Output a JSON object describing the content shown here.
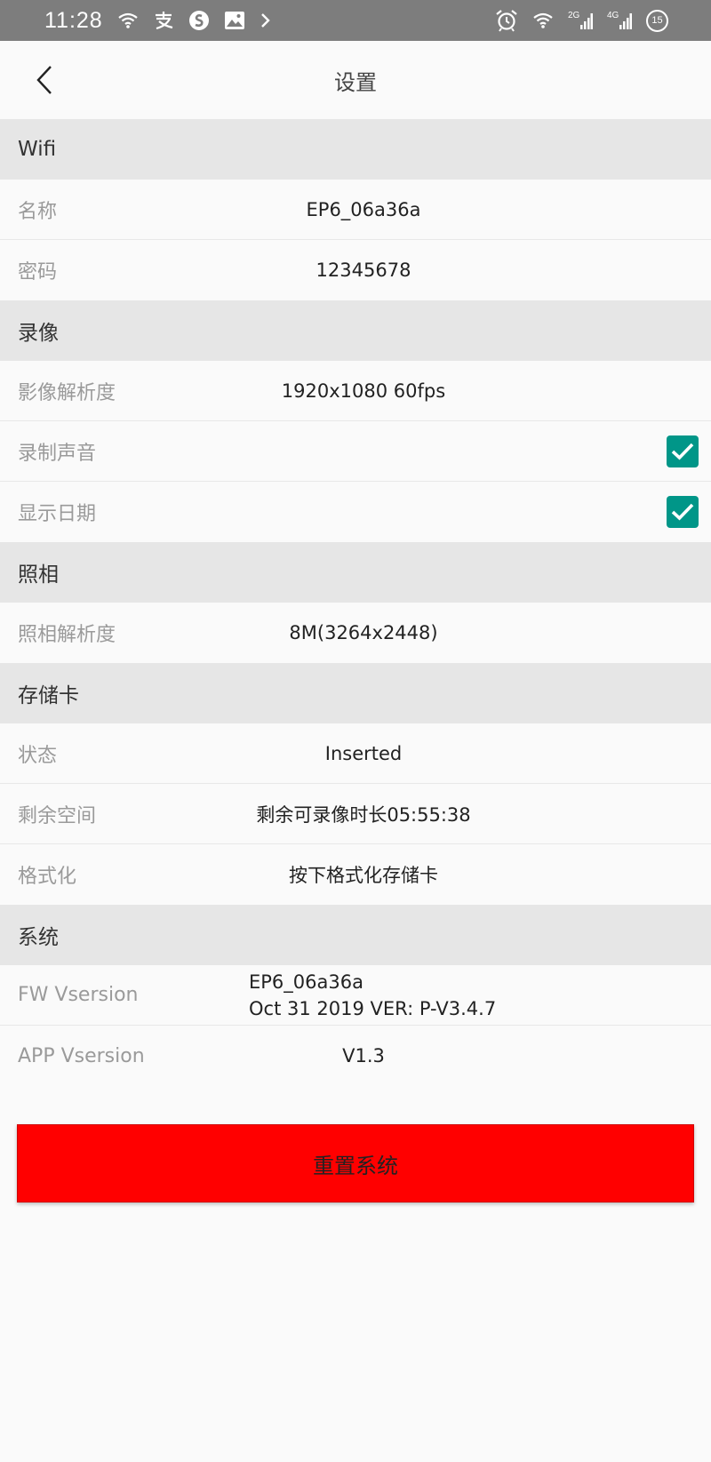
{
  "status_bar": {
    "time": "11:28",
    "left_icons": [
      "wifi-icon",
      "alipay-icon",
      "sogou-icon",
      "gallery-icon",
      "chevron-right-icon"
    ],
    "right_icons": [
      "alarm-icon",
      "wifi-icon",
      "signal-2g-icon",
      "signal-4g-icon"
    ],
    "network_2g": "2G",
    "network_4g": "4G",
    "battery": "15"
  },
  "app_bar": {
    "title": "设置"
  },
  "sections": {
    "wifi": {
      "header": "Wifi",
      "name_label": "名称",
      "name_value": "EP6_06a36a",
      "password_label": "密码",
      "password_value": "12345678"
    },
    "recording": {
      "header": "录像",
      "resolution_label": "影像解析度",
      "resolution_value": "1920x1080 60fps",
      "audio_label": "录制声音",
      "audio_checked": true,
      "date_label": "显示日期",
      "date_checked": true
    },
    "photo": {
      "header": "照相",
      "resolution_label": "照相解析度",
      "resolution_value": "8M(3264x2448)"
    },
    "storage": {
      "header": "存储卡",
      "status_label": "状态",
      "status_value": "Inserted",
      "space_label": "剩余空间",
      "space_value": "剩余可录像时长05:55:38",
      "format_label": "格式化",
      "format_value": "按下格式化存储卡"
    },
    "system": {
      "header": "系统",
      "fw_label": "FW Vsersion",
      "fw_value_line1": "EP6_06a36a",
      "fw_value_line2": "Oct 31 2019 VER: P-V3.4.7",
      "app_label": "APP Vsersion",
      "app_value": "V1.3"
    }
  },
  "reset_button": {
    "label": "重置系统",
    "color": "#ff0000"
  },
  "colors": {
    "accent": "#009688",
    "section_bg": "#e6e6e6",
    "status_bar_bg": "#7d7d7d"
  }
}
